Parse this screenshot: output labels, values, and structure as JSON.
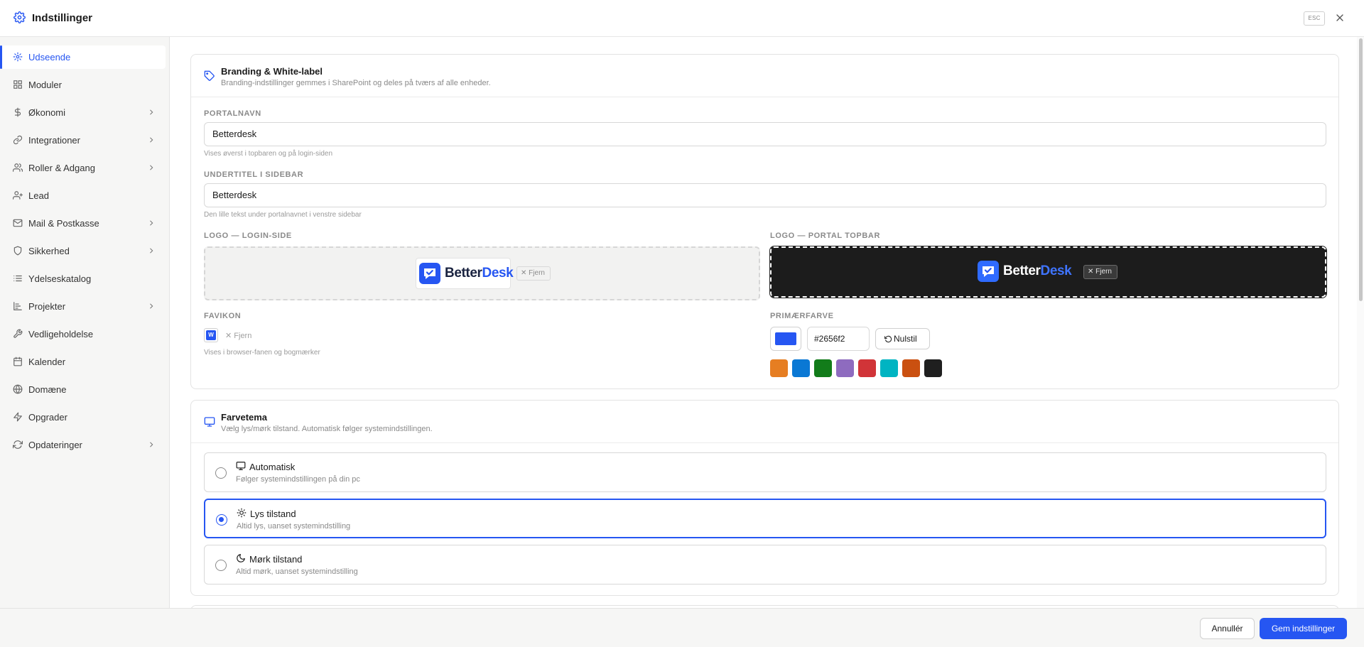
{
  "window": {
    "title": "Indstillinger",
    "esc_label": "ESC"
  },
  "colors": {
    "accent": "#2656f2"
  },
  "sidebar": {
    "items": [
      {
        "label": "Udseende",
        "icon": "gear-icon",
        "active": true
      },
      {
        "label": "Moduler",
        "icon": "grid-icon"
      },
      {
        "label": "Økonomi",
        "icon": "dollar-icon",
        "chevron": true
      },
      {
        "label": "Integrationer",
        "icon": "link-icon",
        "chevron": true
      },
      {
        "label": "Roller & Adgang",
        "icon": "users-icon",
        "chevron": true
      },
      {
        "label": "Lead",
        "icon": "user-plus-icon"
      },
      {
        "label": "Mail & Postkasse",
        "icon": "mail-icon",
        "chevron": true
      },
      {
        "label": "Sikkerhed",
        "icon": "shield-icon",
        "chevron": true
      },
      {
        "label": "Ydelseskatalog",
        "icon": "list-icon"
      },
      {
        "label": "Projekter",
        "icon": "kanban-icon",
        "chevron": true
      },
      {
        "label": "Vedligeholdelse",
        "icon": "wrench-icon"
      },
      {
        "label": "Kalender",
        "icon": "calendar-icon"
      },
      {
        "label": "Domæne",
        "icon": "globe-icon"
      },
      {
        "label": "Opgrader",
        "icon": "zap-icon"
      },
      {
        "label": "Opdateringer",
        "icon": "refresh-icon",
        "chevron": true
      }
    ]
  },
  "branding": {
    "title": "Branding & White-label",
    "subtitle": "Branding-indstillinger gemmes i SharePoint og deles på tværs af alle enheder.",
    "portal_name": {
      "label": "PORTALNAVN",
      "value": "Betterdesk",
      "hint": "Vises øverst i topbaren og på login-siden"
    },
    "sidebar_subtitle": {
      "label": "UNDERTITEL I SIDEBAR",
      "value": "Betterdesk",
      "hint": "Den lille tekst under portalnavnet i venstre sidebar"
    },
    "logo_login": {
      "label": "LOGO — LOGIN-SIDE",
      "wordmark_a": "Better",
      "wordmark_b": "Desk",
      "remove_label": "Fjern"
    },
    "logo_topbar": {
      "label": "LOGO — PORTAL TOPBAR",
      "wordmark_a": "Better",
      "wordmark_b": "Desk",
      "remove_label": "Fjern"
    },
    "favicon": {
      "label": "FAVIKON",
      "remove_label": "Fjern",
      "hint": "Vises i browser-fanen og bogmærker"
    },
    "primary_color": {
      "label": "PRIMÆRFARVE",
      "value": "#2656f2",
      "reset_label": "Nulstil",
      "palette": [
        "#e67e22",
        "#0a78d4",
        "#127c1a",
        "#8e6bbf",
        "#d13438",
        "#00b4c2",
        "#ca5010",
        "#1f1f1f"
      ]
    }
  },
  "theme": {
    "title": "Farvetema",
    "subtitle": "Vælg lys/mørk tilstand. Automatisk følger systemindstillingen.",
    "options": [
      {
        "label": "Automatisk",
        "description": "Følger systemindstillingen på din pc",
        "icon": "monitor-icon",
        "selected": false
      },
      {
        "label": "Lys tilstand",
        "description": "Altid lys, uanset systemindstilling",
        "icon": "sun-icon",
        "selected": true
      },
      {
        "label": "Mørk tilstand",
        "description": "Altid mørk, uanset systemindstilling",
        "icon": "moon-icon",
        "selected": false
      }
    ]
  },
  "footer": {
    "cancel_label": "Annullér",
    "save_label": "Gem indstillinger"
  }
}
